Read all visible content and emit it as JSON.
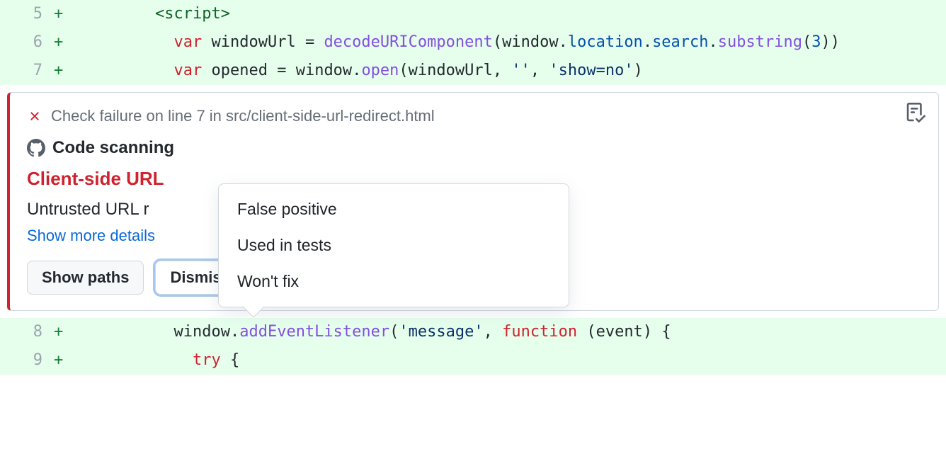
{
  "code": {
    "lines": [
      {
        "num": "5",
        "mark": "+",
        "indent": "    ",
        "tokens": [
          {
            "t": "tag",
            "v": "<script>"
          }
        ]
      },
      {
        "num": "6",
        "mark": "+",
        "indent": "      ",
        "tokens": [
          {
            "t": "key",
            "v": "var"
          },
          {
            "t": "ident",
            "v": " windowUrl "
          },
          {
            "t": "ident",
            "v": "= "
          },
          {
            "t": "func",
            "v": "decodeURIComponent"
          },
          {
            "t": "paren",
            "v": "("
          },
          {
            "t": "ident",
            "v": "window"
          },
          {
            "t": "dot",
            "v": "."
          },
          {
            "t": "prop",
            "v": "location"
          },
          {
            "t": "dot",
            "v": "."
          },
          {
            "t": "prop",
            "v": "search"
          },
          {
            "t": "dot",
            "v": "."
          },
          {
            "t": "func",
            "v": "substring"
          },
          {
            "t": "paren",
            "v": "("
          },
          {
            "t": "num",
            "v": "3"
          },
          {
            "t": "paren",
            "v": ")"
          },
          {
            "t": "paren",
            "v": ")"
          }
        ]
      },
      {
        "num": "7",
        "mark": "+",
        "indent": "      ",
        "tokens": [
          {
            "t": "key",
            "v": "var"
          },
          {
            "t": "ident",
            "v": " opened "
          },
          {
            "t": "ident",
            "v": "= "
          },
          {
            "t": "ident",
            "v": "window"
          },
          {
            "t": "dot",
            "v": "."
          },
          {
            "t": "func",
            "v": "open"
          },
          {
            "t": "paren",
            "v": "("
          },
          {
            "t": "ident",
            "v": "windowUrl"
          },
          {
            "t": "ident",
            "v": ", "
          },
          {
            "t": "str",
            "v": "''"
          },
          {
            "t": "ident",
            "v": ", "
          },
          {
            "t": "str",
            "v": "'show=no'"
          },
          {
            "t": "paren",
            "v": ")"
          }
        ]
      },
      {
        "num": "8",
        "mark": "+",
        "indent": "      ",
        "tokens": [
          {
            "t": "ident",
            "v": "window"
          },
          {
            "t": "dot",
            "v": "."
          },
          {
            "t": "func",
            "v": "addEventListener"
          },
          {
            "t": "paren",
            "v": "("
          },
          {
            "t": "str",
            "v": "'message'"
          },
          {
            "t": "ident",
            "v": ", "
          },
          {
            "t": "key",
            "v": "function"
          },
          {
            "t": "ident",
            "v": " "
          },
          {
            "t": "paren",
            "v": "("
          },
          {
            "t": "ident",
            "v": "event"
          },
          {
            "t": "paren",
            "v": ")"
          },
          {
            "t": "ident",
            "v": " "
          },
          {
            "t": "paren",
            "v": "{"
          }
        ]
      },
      {
        "num": "9",
        "mark": "+",
        "indent": "        ",
        "tokens": [
          {
            "t": "key",
            "v": "try"
          },
          {
            "t": "ident",
            "v": " "
          },
          {
            "t": "paren",
            "v": "{"
          }
        ]
      }
    ]
  },
  "alert": {
    "header": "Check failure on line 7 in src/client-side-url-redirect.html",
    "source": "Code scanning",
    "title_partial": "Client-side URL",
    "body_partial": "Untrusted URL r",
    "details_link_partial": "Show more details",
    "buttons": {
      "show_paths": "Show paths",
      "dismiss": "Dismiss"
    },
    "menu": {
      "items": [
        "False positive",
        "Used in tests",
        "Won't fix"
      ]
    }
  }
}
